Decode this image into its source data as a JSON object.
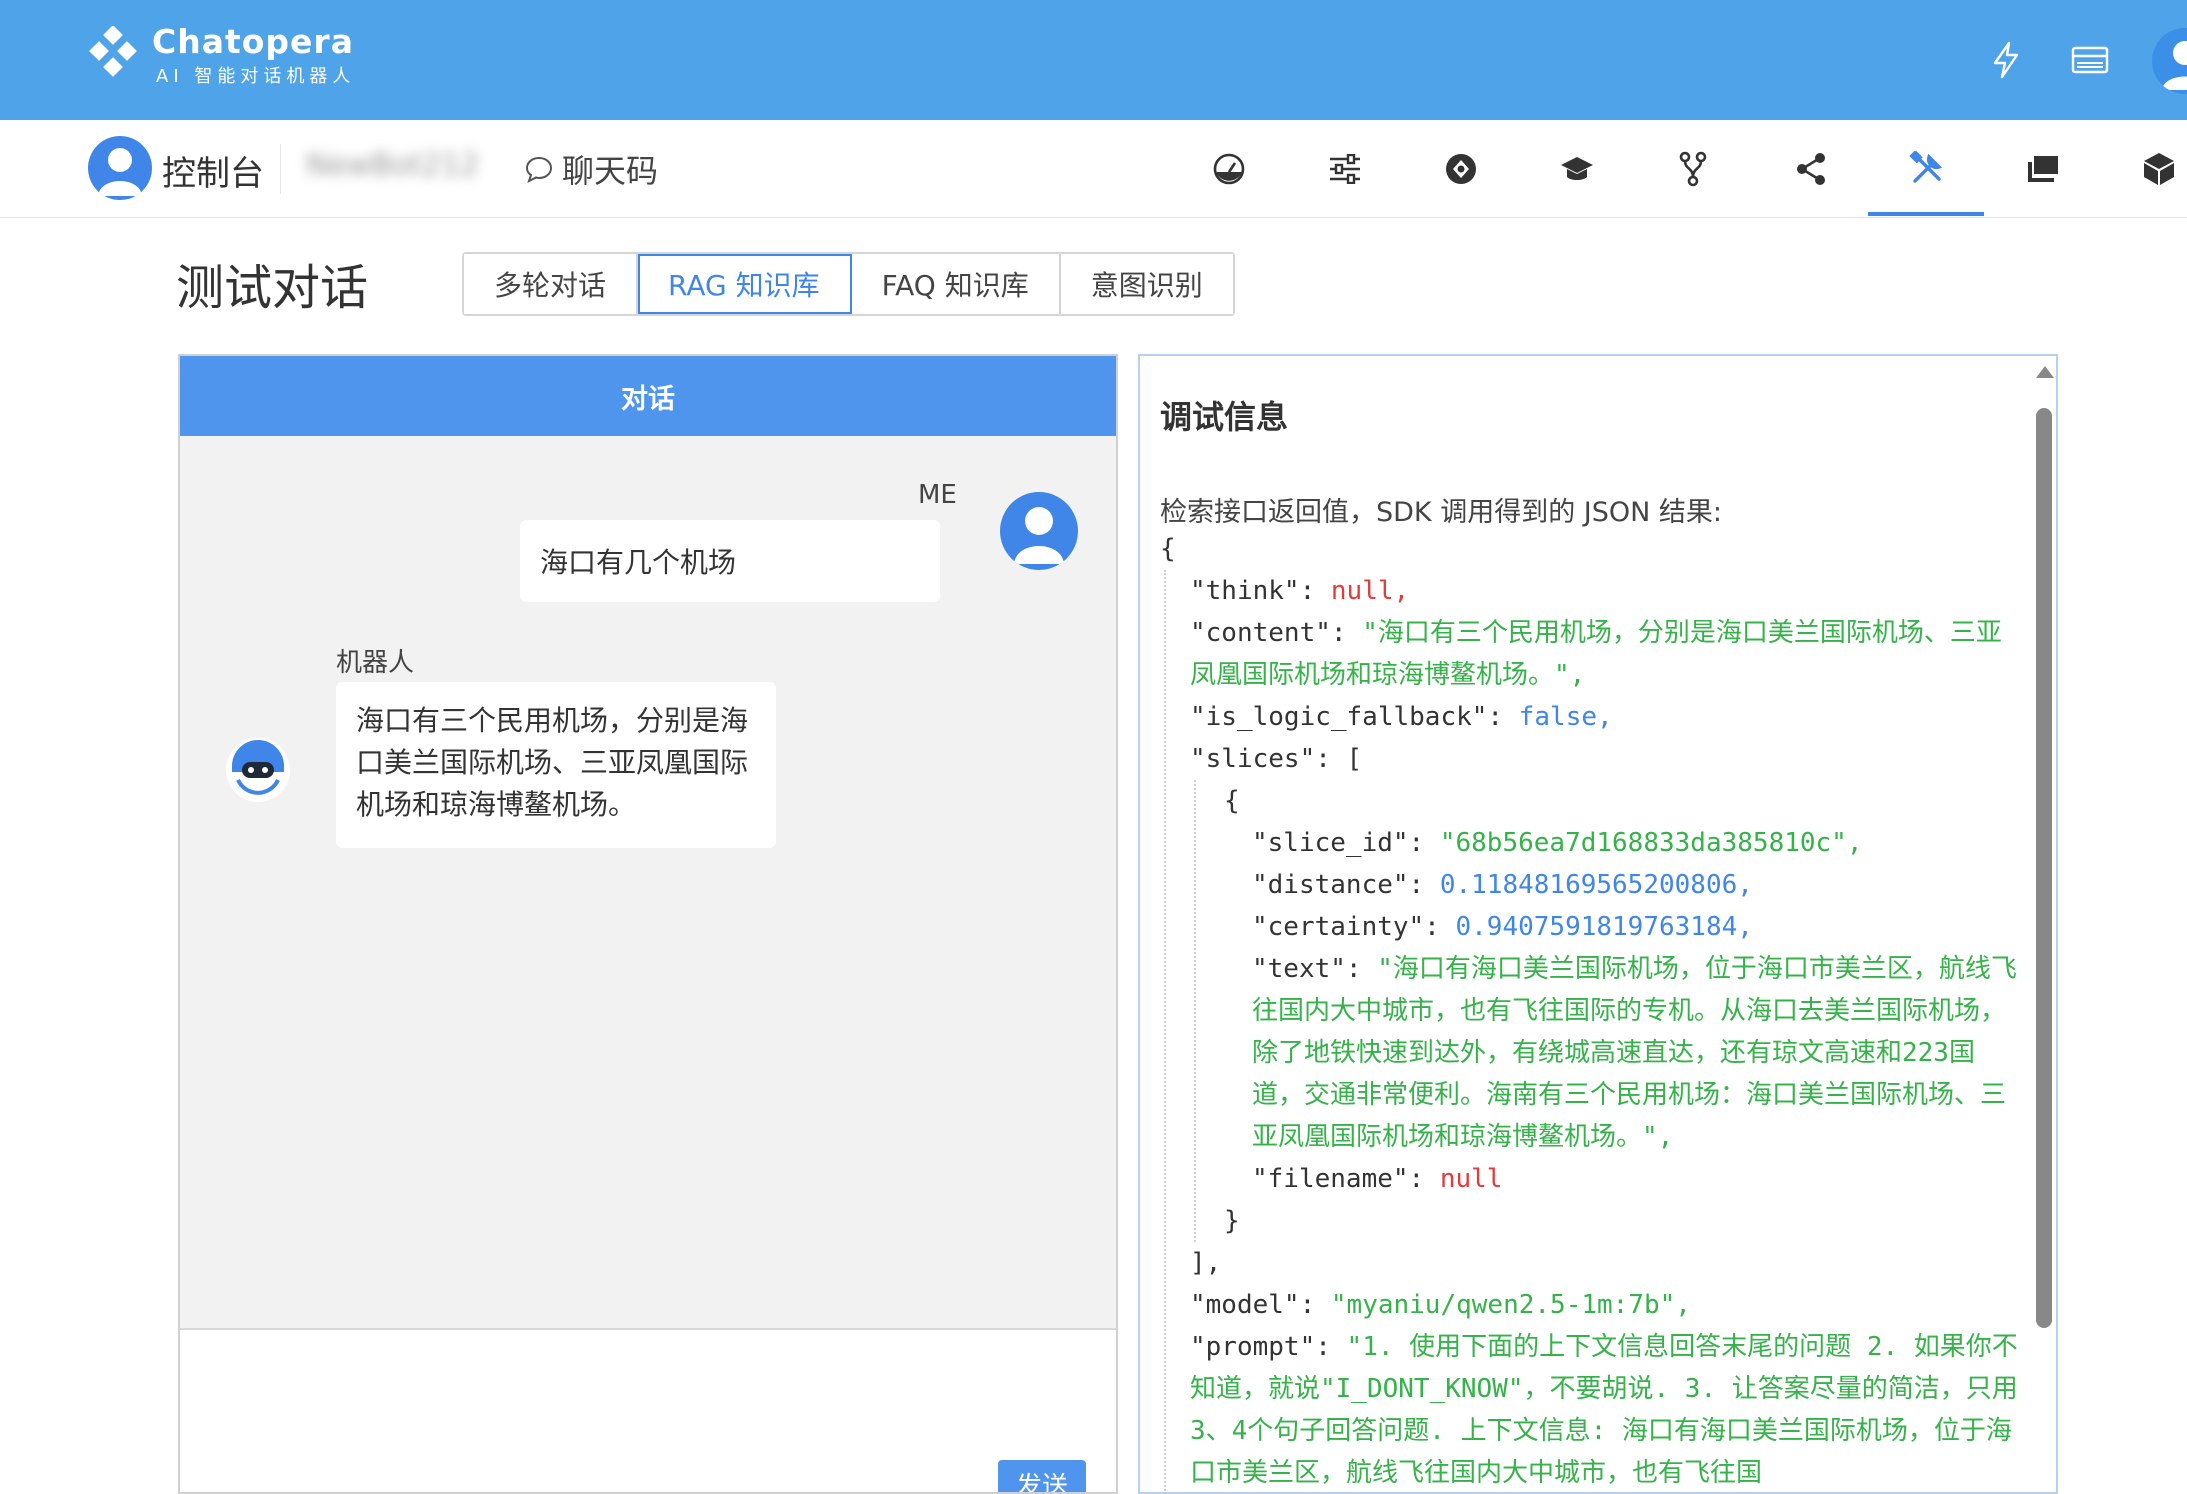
{
  "topbar": {
    "brand_name": "Chatopera",
    "brand_sub": "AI 智能对话机器人",
    "icons": [
      "lightning-icon",
      "card-icon",
      "user-avatar"
    ]
  },
  "navbar": {
    "title": "控制台",
    "bot_name": "NewBot212",
    "chat_code_label": "聊天码",
    "icons": [
      "dashboard-icon",
      "settings-sliders-icon",
      "api-icon",
      "graduation-cap-icon",
      "branch-icon",
      "share-icon",
      "tools-icon",
      "chat-window-icon",
      "cube-icon"
    ],
    "active_icon": "tools-icon"
  },
  "page": {
    "title": "测试对话",
    "tabs": [
      "多轮对话",
      "RAG 知识库",
      "FAQ 知识库",
      "意图识别"
    ],
    "active_tab": "RAG 知识库"
  },
  "chat": {
    "header": "对话",
    "me_label": "ME",
    "me_message": "海口有几个机场",
    "bot_label": "机器人",
    "bot_message": "海口有三个民用机场，分别是海口美兰国际机场、三亚凤凰国际机场和琼海博鳌机场。",
    "send_label": "发送"
  },
  "debug": {
    "title": "调试信息",
    "description": "检索接口返回值，SDK 调用得到的 JSON 结果:",
    "json": {
      "think": "null,",
      "content": "\"海口有三个民用机场，分别是海口美兰国际机场、三亚凤凰国际机场和琼海博鳌机场。\",",
      "is_logic_fallback": "false,",
      "slice_id": "\"68b56ea7d168833da385810c\",",
      "distance": "0.11848169565200806,",
      "certainty": "0.9407591819763184,",
      "text": "\"海口有海口美兰国际机场，位于海口市美兰区，航线飞往国内大中城市，也有飞往国际的专机。从海口去美兰国际机场，除了地铁快速到达外，有绕城高速直达，还有琼文高速和223国道，交通非常便利。海南有三个民用机场：海口美兰国际机场、三亚凤凰国际机场和琼海博鳌机场。\",",
      "filename": "null",
      "model": "\"myaniu/qwen2.5-1m:7b\",",
      "prompt": "\"1. 使用下面的上下文信息回答末尾的问题 2. 如果你不知道，就说\"I_DONT_KNOW\"，不要胡说. 3. 让答案尽量的简洁，只用3、4个句子回答问题. 上下文信息: 海口有海口美兰国际机场，位于海口市美兰区，航线飞往国内大中城市，也有飞往国"
    }
  },
  "colors": {
    "topbar": "#4fa3e8",
    "accent": "#3f86e8",
    "chat_header": "#4f95ee",
    "string": "#36b24a",
    "number": "#3f86e8",
    "null": "#e23c3c"
  }
}
